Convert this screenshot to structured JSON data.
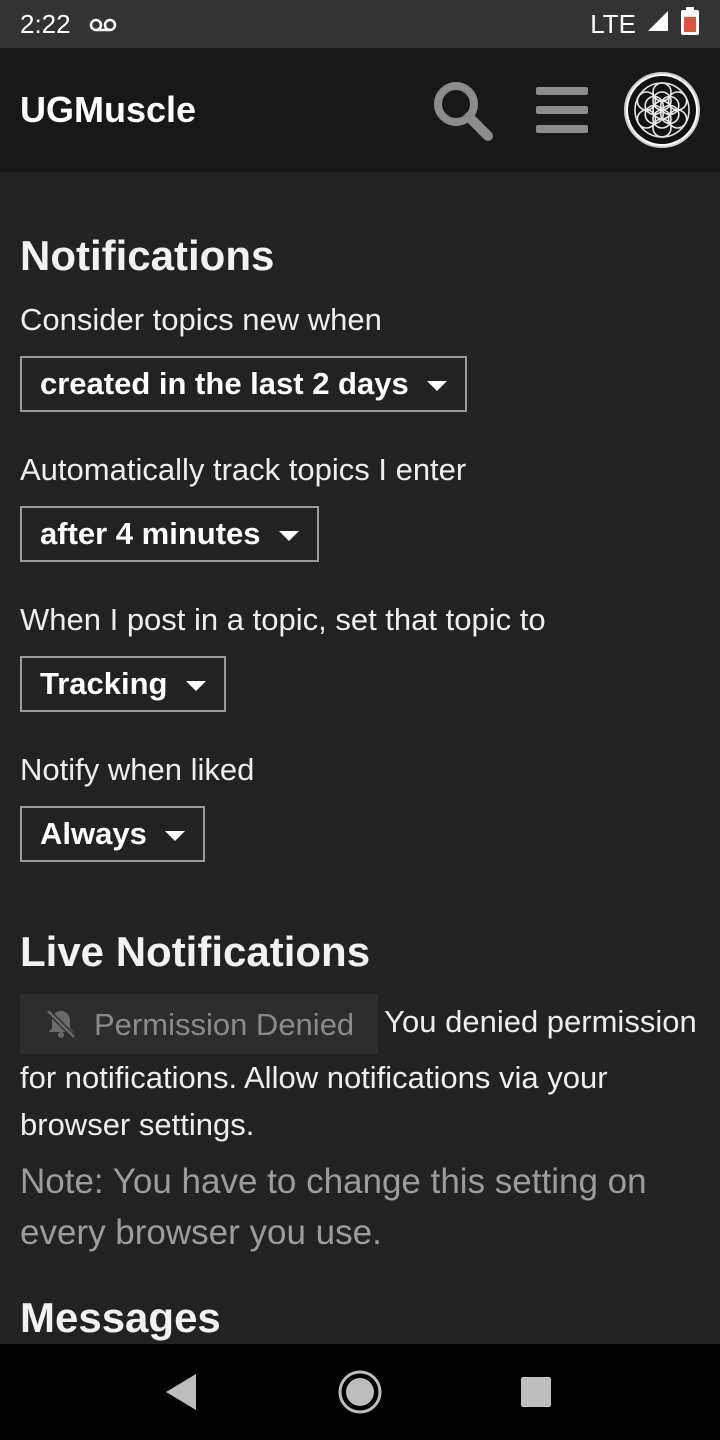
{
  "status_bar": {
    "time": "2:22",
    "network": "LTE",
    "icons": [
      "voicemail-icon",
      "signal-icon",
      "battery-icon"
    ]
  },
  "header": {
    "site_title": "UGMuscle",
    "icons": [
      "search-icon",
      "hamburger-menu-icon",
      "avatar"
    ]
  },
  "notifications": {
    "title": "Notifications",
    "settings": [
      {
        "label": "Consider topics new when",
        "value": "created in the last 2 days"
      },
      {
        "label": "Automatically track topics I enter",
        "value": "after 4 minutes"
      },
      {
        "label": "When I post in a topic, set that topic to",
        "value": "Tracking"
      },
      {
        "label": "Notify when liked",
        "value": "Always"
      }
    ]
  },
  "live_notifications": {
    "title": "Live Notifications",
    "button_label": "Permission Denied",
    "message": "You denied permission for notifications. Allow notifications via your browser settings.",
    "note": "Note: You have to change this setting on every browser you use."
  },
  "messages": {
    "title": "Messages"
  },
  "nav_bar": {
    "icons": [
      "back-icon",
      "home-icon",
      "recents-icon"
    ]
  },
  "colors": {
    "background": "#222222",
    "header_background": "#181818",
    "text": "#f2f2f2",
    "muted_text": "#9c9c9c",
    "select_border": "#9a9a9a"
  }
}
